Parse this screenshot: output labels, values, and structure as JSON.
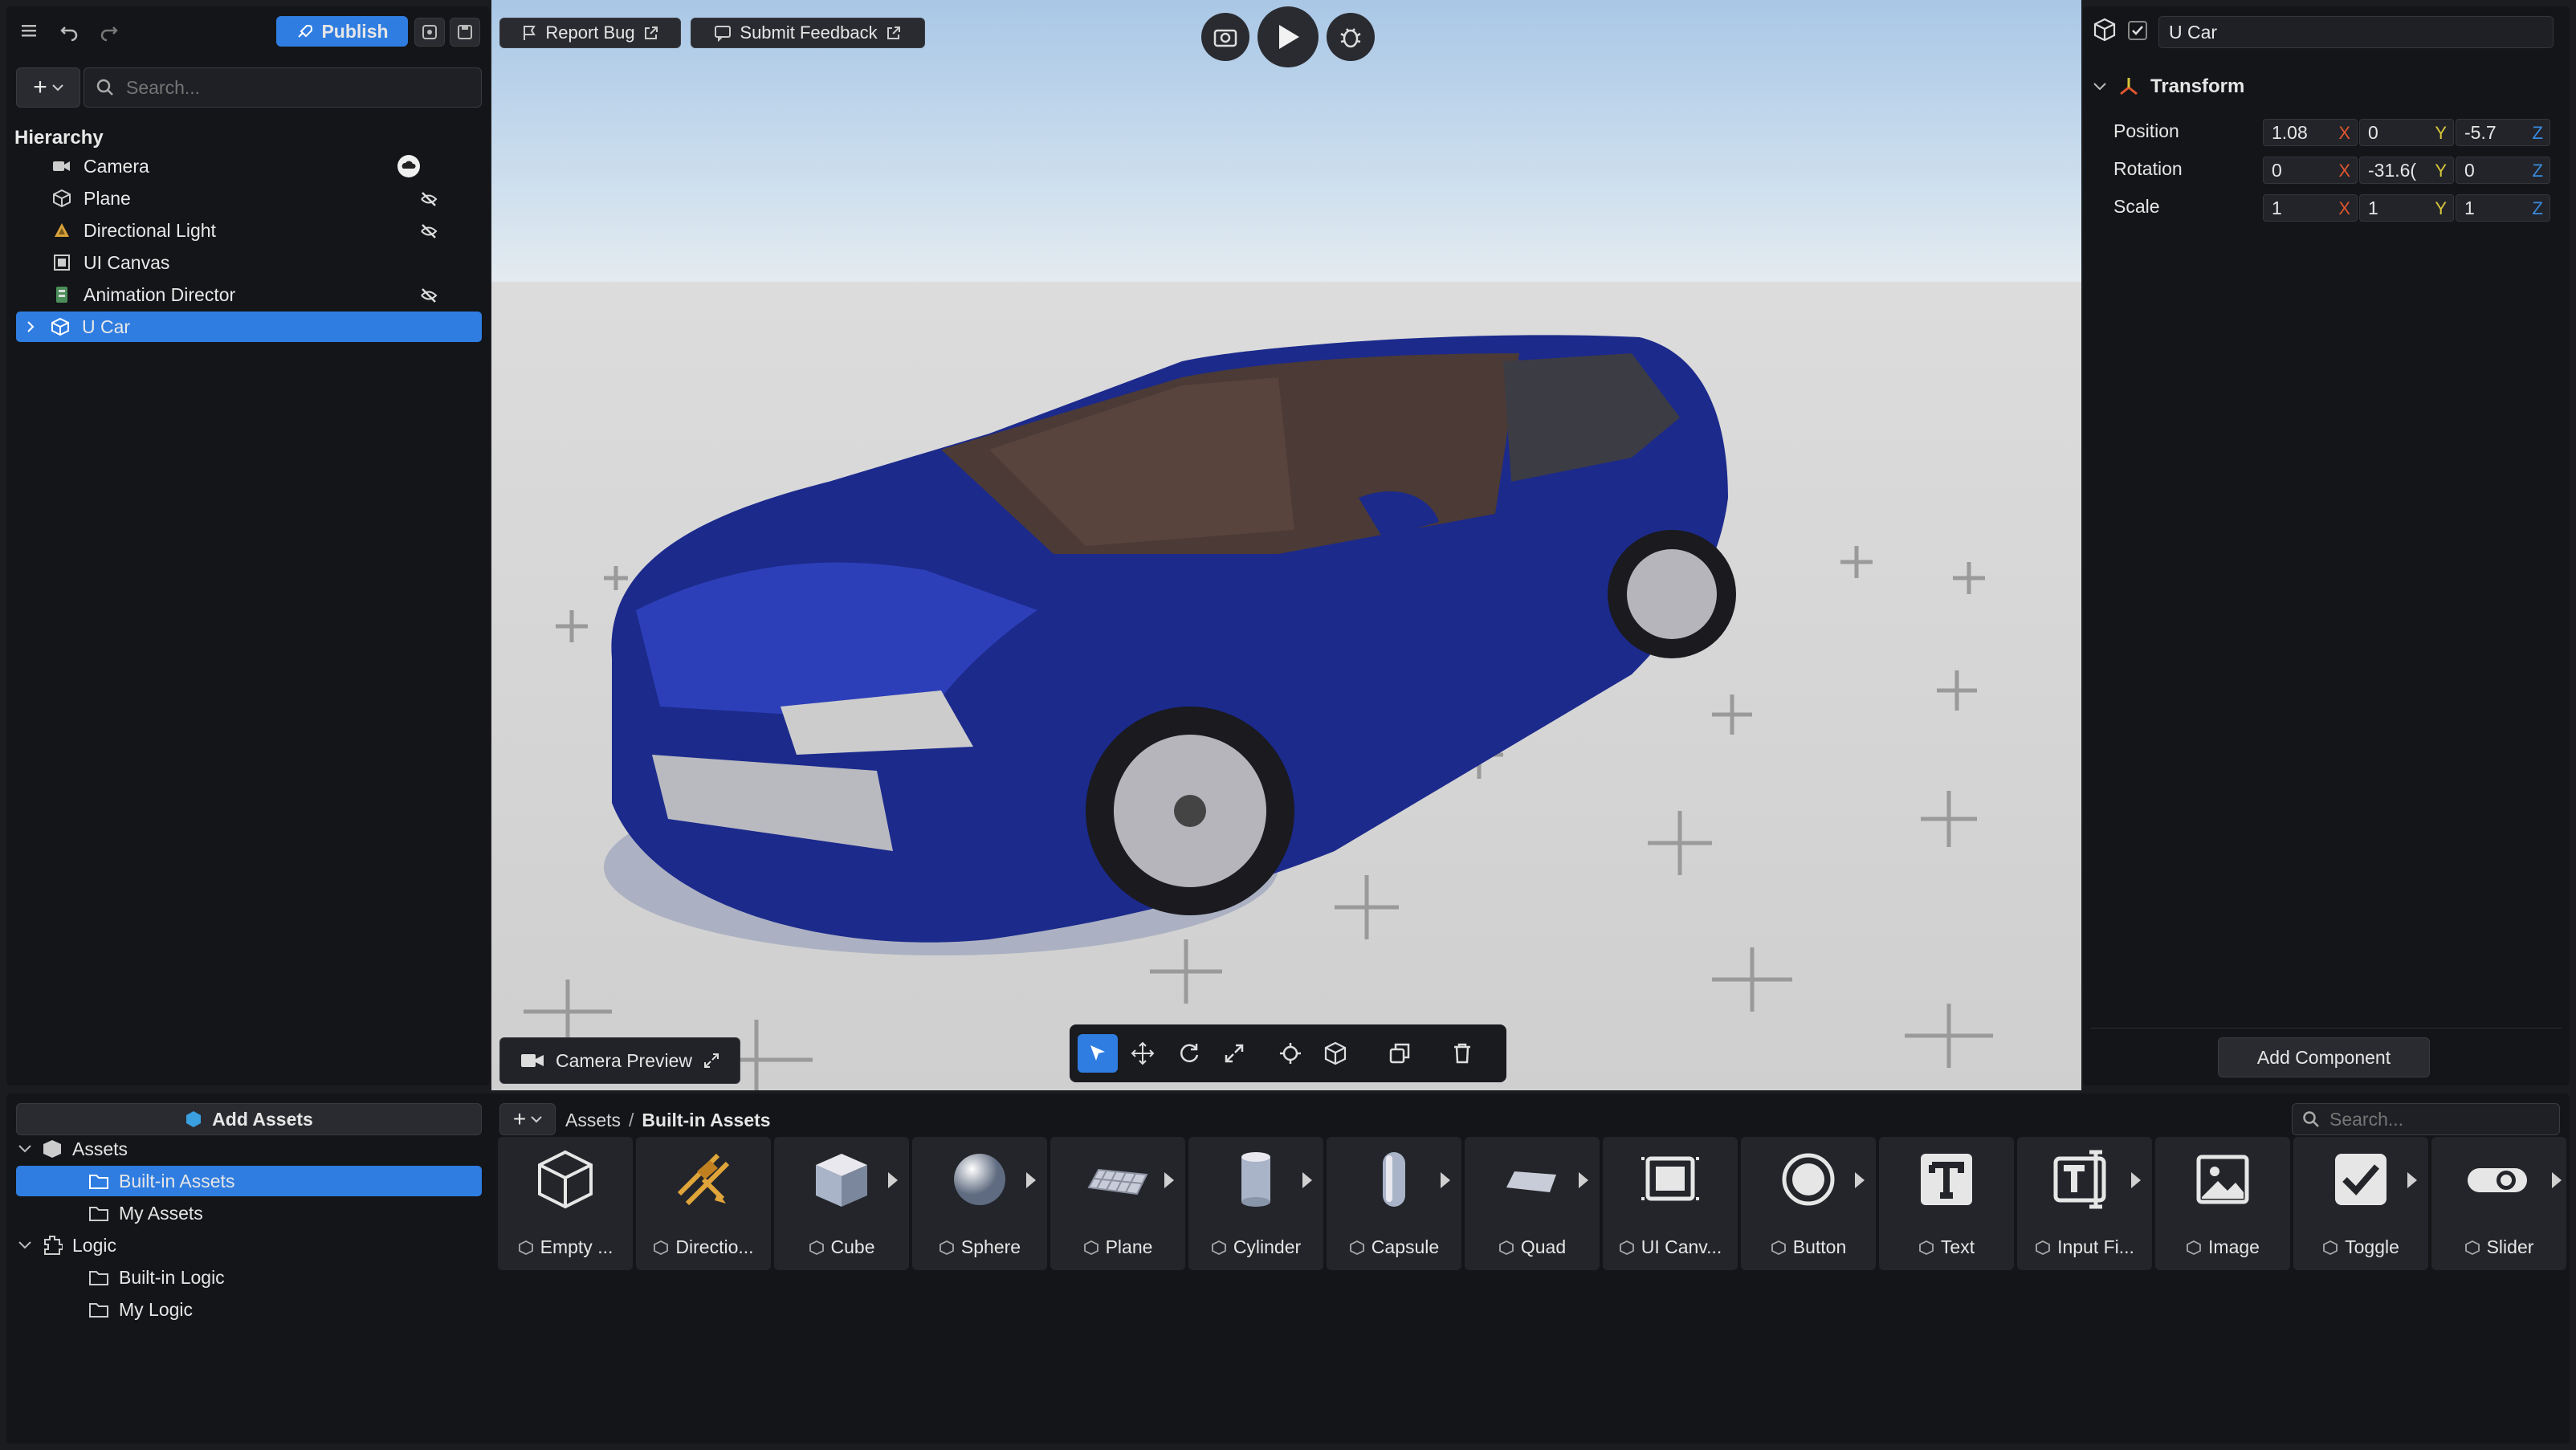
{
  "toolbar": {
    "publish_label": "Publish",
    "report_bug_label": "Report Bug",
    "submit_feedback_label": "Submit Feedback"
  },
  "hierarchy": {
    "search_placeholder": "Search...",
    "title": "Hierarchy",
    "items": [
      {
        "label": "Camera",
        "icon": "camera-icon"
      },
      {
        "label": "Plane",
        "icon": "cube-icon"
      },
      {
        "label": "Directional Light",
        "icon": "light-icon"
      },
      {
        "label": "UI Canvas",
        "icon": "canvas-icon"
      },
      {
        "label": "Animation Director",
        "icon": "director-icon"
      },
      {
        "label": "U Car",
        "icon": "cube-icon",
        "selected": true
      }
    ]
  },
  "viewport": {
    "camera_preview_label": "Camera Preview"
  },
  "inspector": {
    "object_name": "U Car",
    "transform_title": "Transform",
    "rows": [
      {
        "label": "Position",
        "x": "1.08",
        "y": "0",
        "z": "-5.7"
      },
      {
        "label": "Rotation",
        "x": "0",
        "y": "-31.6(",
        "z": "0"
      },
      {
        "label": "Scale",
        "x": "1",
        "y": "1",
        "z": "1"
      }
    ],
    "axis_labels": {
      "x": "X",
      "y": "Y",
      "z": "Z"
    },
    "add_component_label": "Add Component"
  },
  "assets_panel": {
    "add_assets_label": "Add Assets",
    "tree": [
      {
        "label": "Assets"
      },
      {
        "label": "Built-in Assets",
        "selected": true
      },
      {
        "label": "My Assets"
      },
      {
        "label": "Logic"
      },
      {
        "label": "Built-in Logic"
      },
      {
        "label": "My Logic"
      }
    ],
    "breadcrumb": {
      "root": "Assets",
      "separator": "/",
      "current": "Built-in Assets"
    },
    "search_placeholder": "Search...",
    "items": [
      {
        "label": "Empty ...",
        "icon": "empty-cube-icon"
      },
      {
        "label": "Directio...",
        "icon": "directional-light-icon"
      },
      {
        "label": "Cube",
        "icon": "cube-icon"
      },
      {
        "label": "Sphere",
        "icon": "sphere-icon"
      },
      {
        "label": "Plane",
        "icon": "plane-icon"
      },
      {
        "label": "Cylinder",
        "icon": "cylinder-icon"
      },
      {
        "label": "Capsule",
        "icon": "capsule-icon"
      },
      {
        "label": "Quad",
        "icon": "quad-icon"
      },
      {
        "label": "UI Canv...",
        "icon": "ui-canvas-icon"
      },
      {
        "label": "Button",
        "icon": "button-icon"
      },
      {
        "label": "Text",
        "icon": "text-icon"
      },
      {
        "label": "Input Fi...",
        "icon": "input-field-icon"
      },
      {
        "label": "Image",
        "icon": "image-icon"
      },
      {
        "label": "Toggle",
        "icon": "toggle-icon"
      },
      {
        "label": "Slider",
        "icon": "slider-icon"
      }
    ]
  },
  "colors": {
    "accent": "#2f7de1",
    "panel": "#141518",
    "axis_x": "#e0572f",
    "axis_y": "#d8c63a",
    "axis_z": "#3a8be0",
    "car_body": "#1c2a8c"
  }
}
